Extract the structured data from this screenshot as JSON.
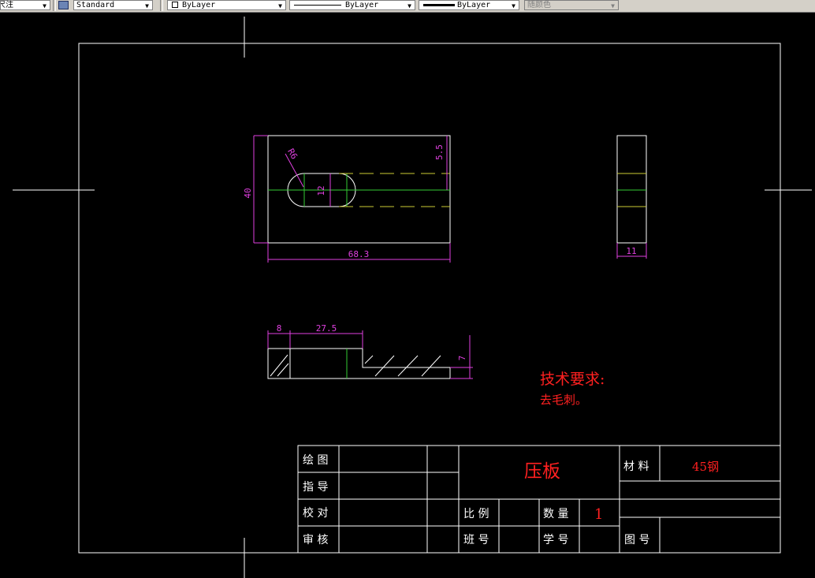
{
  "toolbar": {
    "dimstyle_label": "尺注",
    "text_style": "Standard",
    "layer": "ByLayer",
    "linetype": "ByLayer",
    "lineweight": "ByLayer",
    "plotstyle": "随颜色"
  },
  "drawing": {
    "dimensions": {
      "front_radius": "R6",
      "front_slot_height": "12",
      "front_offset": "5.5",
      "front_height": "40",
      "front_width": "68.3",
      "side_width": "11",
      "section_left": "8",
      "section_mid": "27.5",
      "section_thickness": "7"
    },
    "tech_requirements_title": "技术要求:",
    "tech_requirements_item": "去毛刺。"
  },
  "title_block": {
    "drawn_by": "绘 图",
    "guided_by": "指 导",
    "checked_by": "校 对",
    "reviewed_by": "审 核",
    "part_name": "压板",
    "material_label": "材 料",
    "material_value": "45钢",
    "scale_label": "比 例",
    "quantity_label": "数 量",
    "quantity_value": "1",
    "class_label": "班 号",
    "student_id_label": "学 号",
    "drawing_no_label": "图 号"
  }
}
